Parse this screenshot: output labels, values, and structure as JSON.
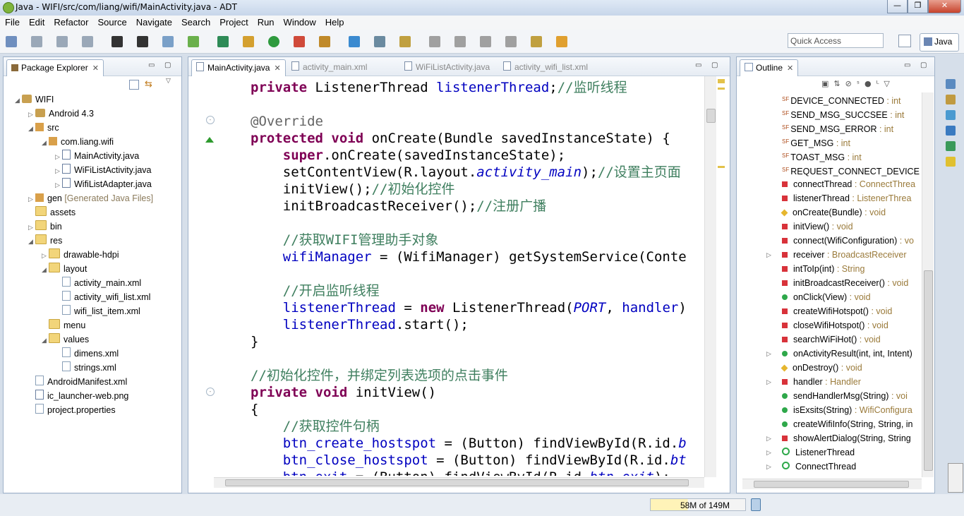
{
  "window": {
    "title": "Java - WIFI/src/com/liang/wifi/MainActivity.java - ADT"
  },
  "menu": [
    "File",
    "Edit",
    "Refactor",
    "Source",
    "Navigate",
    "Search",
    "Project",
    "Run",
    "Window",
    "Help"
  ],
  "toolbar": {
    "quick_access_placeholder": "Quick Access",
    "perspective": "Java"
  },
  "package_explorer": {
    "tab": "Package Explorer",
    "tree": [
      {
        "label": "WIFI",
        "icon": "project-icon",
        "depth": 0,
        "expanded": true
      },
      {
        "label": "Android 4.3",
        "icon": "library-icon",
        "depth": 1,
        "expanded": false
      },
      {
        "label": "src",
        "icon": "source-folder-icon",
        "depth": 1,
        "expanded": true
      },
      {
        "label": "com.liang.wifi",
        "icon": "package-icon",
        "depth": 2,
        "expanded": true
      },
      {
        "label": "MainActivity.java",
        "icon": "java-file-icon",
        "depth": 3,
        "expanded": false
      },
      {
        "label": "WiFiListActivity.java",
        "icon": "java-file-icon",
        "depth": 3,
        "expanded": false
      },
      {
        "label": "WifiListAdapter.java",
        "icon": "java-file-icon",
        "depth": 3,
        "expanded": false
      },
      {
        "label": "gen",
        "suffix": "[Generated Java Files]",
        "icon": "source-folder-icon",
        "depth": 1,
        "expanded": false
      },
      {
        "label": "assets",
        "icon": "folder-icon",
        "depth": 1
      },
      {
        "label": "bin",
        "icon": "folder-icon",
        "depth": 1,
        "expanded": false
      },
      {
        "label": "res",
        "icon": "folder-icon",
        "depth": 1,
        "expanded": true
      },
      {
        "label": "drawable-hdpi",
        "icon": "folder-icon",
        "depth": 2,
        "expanded": false
      },
      {
        "label": "layout",
        "icon": "folder-icon",
        "depth": 2,
        "expanded": true
      },
      {
        "label": "activity_main.xml",
        "icon": "xml-file-icon",
        "depth": 3
      },
      {
        "label": "activity_wifi_list.xml",
        "icon": "xml-file-icon",
        "depth": 3
      },
      {
        "label": "wifi_list_item.xml",
        "icon": "xml-file-icon",
        "depth": 3
      },
      {
        "label": "menu",
        "icon": "folder-icon",
        "depth": 2
      },
      {
        "label": "values",
        "icon": "folder-icon",
        "depth": 2,
        "expanded": true
      },
      {
        "label": "dimens.xml",
        "icon": "xml-file-icon",
        "depth": 3
      },
      {
        "label": "strings.xml",
        "icon": "xml-file-icon",
        "depth": 3
      },
      {
        "label": "AndroidManifest.xml",
        "icon": "manifest-icon",
        "depth": 1
      },
      {
        "label": "ic_launcher-web.png",
        "icon": "image-file-icon",
        "depth": 1
      },
      {
        "label": "project.properties",
        "icon": "properties-file-icon",
        "depth": 1
      }
    ]
  },
  "editor": {
    "tabs": [
      "MainActivity.java",
      "activity_main.xml",
      "WiFiListActivity.java",
      "activity_wifi_list.xml"
    ],
    "lines": [
      [
        [
          "kw",
          "private "
        ],
        [
          "",
          "ListenerThread "
        ],
        [
          "fld",
          "listenerThread"
        ],
        [
          "",
          ";"
        ],
        [
          "cm",
          "//监听线程"
        ]
      ],
      [],
      [
        [
          "ann",
          "@Override"
        ]
      ],
      [
        [
          "kw",
          "protected "
        ],
        [
          "kw",
          "void "
        ],
        [
          "",
          "onCreate(Bundle savedInstanceState) {"
        ]
      ],
      [
        [
          "",
          "    "
        ],
        [
          "kw",
          "super"
        ],
        [
          "",
          ".onCreate(savedInstanceState);"
        ]
      ],
      [
        [
          "",
          "    setContentView(R.layout."
        ],
        [
          "sfld",
          "activity_main"
        ],
        [
          "",
          ");"
        ],
        [
          "cm",
          "//设置主页面"
        ]
      ],
      [
        [
          "",
          "    initView();"
        ],
        [
          "cm",
          "//初始化控件"
        ]
      ],
      [
        [
          "",
          "    initBroadcastReceiver();"
        ],
        [
          "cm",
          "//注册广播"
        ]
      ],
      [],
      [
        [
          "",
          "    "
        ],
        [
          "cm",
          "//获取WIFI管理助手对象"
        ]
      ],
      [
        [
          "",
          "    "
        ],
        [
          "fld",
          "wifiManager"
        ],
        [
          "",
          " = (WifiManager) getSystemService(Conte"
        ]
      ],
      [],
      [
        [
          "",
          "    "
        ],
        [
          "cm",
          "//开启监听线程"
        ]
      ],
      [
        [
          "",
          "    "
        ],
        [
          "fld",
          "listenerThread"
        ],
        [
          "",
          " = "
        ],
        [
          "kw",
          "new "
        ],
        [
          "",
          "ListenerThread("
        ],
        [
          "sfld",
          "PORT"
        ],
        [
          "",
          ", "
        ],
        [
          "fld",
          "handler"
        ],
        [
          "",
          ")"
        ]
      ],
      [
        [
          "",
          "    "
        ],
        [
          "fld",
          "listenerThread"
        ],
        [
          "",
          ".start();"
        ]
      ],
      [
        [
          "",
          "}"
        ]
      ],
      [],
      [
        [
          "cm",
          "//初始化控件，并绑定列表选项的点击事件"
        ]
      ],
      [
        [
          "kw",
          "private "
        ],
        [
          "kw",
          "void "
        ],
        [
          "",
          "initView()"
        ]
      ],
      [
        [
          "",
          "{"
        ]
      ],
      [
        [
          "",
          "    "
        ],
        [
          "cm",
          "//获取控件句柄"
        ]
      ],
      [
        [
          "",
          "    "
        ],
        [
          "fld",
          "btn_create_hostspot"
        ],
        [
          "",
          " = (Button) findViewById(R.id."
        ],
        [
          "sfld",
          "b"
        ]
      ],
      [
        [
          "",
          "    "
        ],
        [
          "fld",
          "btn_close_hostspot"
        ],
        [
          "",
          " = (Button) findViewById(R.id."
        ],
        [
          "sfld",
          "bt"
        ]
      ],
      [
        [
          "",
          "    "
        ],
        [
          "fld",
          "btn_exit"
        ],
        [
          "",
          " = (Button) findViewById(R.id."
        ],
        [
          "sfld",
          "btn_exit"
        ],
        [
          "",
          ");"
        ]
      ]
    ]
  },
  "outline": {
    "tab": "Outline",
    "items": [
      {
        "kind": "static-final",
        "name": "DEVICE_CONNECTED",
        "type": " : int"
      },
      {
        "kind": "static-final",
        "name": "SEND_MSG_SUCCSEE",
        "type": " : int"
      },
      {
        "kind": "static-final",
        "name": "SEND_MSG_ERROR",
        "type": " : int"
      },
      {
        "kind": "static-final",
        "name": "GET_MSG",
        "type": " : int"
      },
      {
        "kind": "static-final",
        "name": "TOAST_MSG",
        "type": " : int"
      },
      {
        "kind": "static-final",
        "name": "REQUEST_CONNECT_DEVICE",
        "type": ""
      },
      {
        "kind": "private-field",
        "name": "connectThread",
        "type": " : ConnectThrea"
      },
      {
        "kind": "private-field",
        "name": "listenerThread",
        "type": " : ListenerThrea"
      },
      {
        "kind": "protected-method",
        "name": "onCreate(Bundle)",
        "type": " : void"
      },
      {
        "kind": "private-method",
        "name": "initView()",
        "type": " : void"
      },
      {
        "kind": "private-method",
        "name": "connect(WifiConfiguration)",
        "type": " : vo"
      },
      {
        "kind": "field",
        "name": "receiver",
        "type": " : BroadcastReceiver",
        "expandable": true
      },
      {
        "kind": "private-method",
        "name": "intToIp(int)",
        "type": " : String"
      },
      {
        "kind": "private-method",
        "name": "initBroadcastReceiver()",
        "type": " : void"
      },
      {
        "kind": "public-method",
        "name": "onClick(View)",
        "type": " : void"
      },
      {
        "kind": "private-method",
        "name": "createWifiHotspot()",
        "type": " : void"
      },
      {
        "kind": "private-method",
        "name": "closeWifiHotspot()",
        "type": " : void"
      },
      {
        "kind": "private-method",
        "name": "searchWiFiHot()",
        "type": " : void"
      },
      {
        "kind": "public-method",
        "name": "onActivityResult(int, int, Intent)",
        "type": "",
        "expandable": true
      },
      {
        "kind": "protected-method",
        "name": "onDestroy()",
        "type": " : void"
      },
      {
        "kind": "private-field",
        "name": "handler",
        "type": " : Handler",
        "expandable": true
      },
      {
        "kind": "public-method",
        "name": "sendHandlerMsg(String)",
        "type": " : voi"
      },
      {
        "kind": "public-method",
        "name": "isExsits(String)",
        "type": " : WifiConfigura"
      },
      {
        "kind": "public-method",
        "name": "createWifiInfo(String, String, in",
        "type": ""
      },
      {
        "kind": "private-method",
        "name": "showAlertDialog(String, String",
        "type": "",
        "expandable": true
      },
      {
        "kind": "class",
        "name": "ListenerThread",
        "type": "",
        "expandable": true
      },
      {
        "kind": "class",
        "name": "ConnectThread",
        "type": "",
        "expandable": true
      }
    ]
  },
  "status": {
    "heap": "58M of 149M",
    "heap_used_fraction": 0.39
  },
  "colors": {
    "keyword": "#7f0055",
    "field": "#0000c0",
    "comment": "#3f7f5f",
    "annotation": "#646464"
  }
}
